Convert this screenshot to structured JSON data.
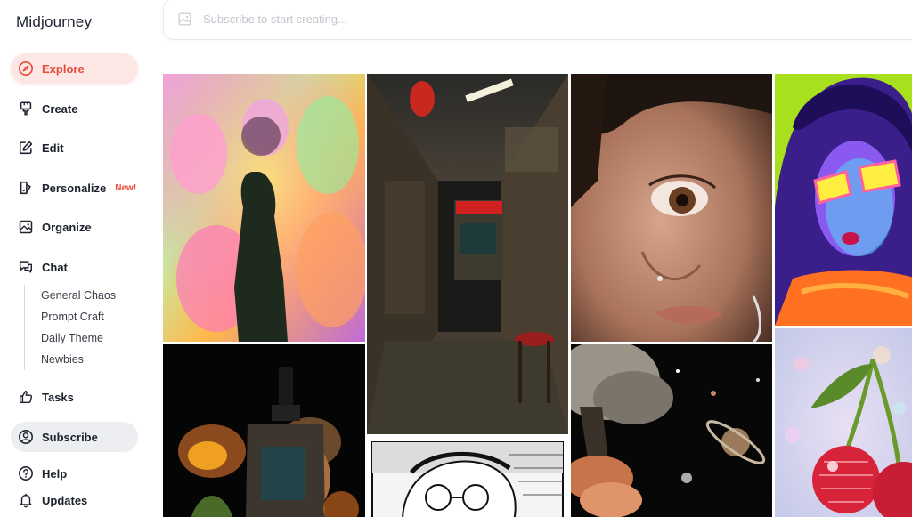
{
  "app": {
    "brand": "Midjourney"
  },
  "nav": {
    "explore": "Explore",
    "create": "Create",
    "edit": "Edit",
    "personalize": "Personalize",
    "personalize_badge": "New!",
    "organize": "Organize",
    "chat": "Chat",
    "chat_channels": [
      "General Chaos",
      "Prompt Craft",
      "Daily Theme",
      "Newbies"
    ],
    "tasks": "Tasks",
    "subscribe": "Subscribe",
    "help": "Help",
    "updates": "Updates"
  },
  "search": {
    "placeholder": "Subscribe to start creating..."
  },
  "colors": {
    "accent": "#e8493a",
    "active_bg": "#fde7e4",
    "subscribe_bg": "#eceef1"
  },
  "gallery": [
    {
      "name": "neon-cats-silhouette-image"
    },
    {
      "name": "retro-arcade-alley-image"
    },
    {
      "name": "freckled-face-closeup-image"
    },
    {
      "name": "pop-art-sunglasses-girl-image"
    },
    {
      "name": "serum-bottle-product-image"
    },
    {
      "name": "cosmic-tree-planets-image"
    },
    {
      "name": "manga-glasses-portrait-image"
    },
    {
      "name": "disco-cherries-image"
    }
  ]
}
